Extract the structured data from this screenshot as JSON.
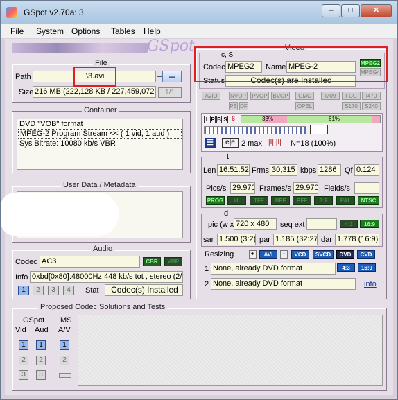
{
  "window": {
    "title": "GSpot v2.70a: 3"
  },
  "menu": [
    "File",
    "System",
    "Options",
    "Tables",
    "Help"
  ],
  "logo_text": "GSpot",
  "file": {
    "group_label": "File",
    "path_label": "Path",
    "path_value": "\\3.avi",
    "browse_label": "...",
    "size_label": "Size",
    "size_value": "216 MB (222,128 KB / 227,459,072",
    "page_indicator": "1/1"
  },
  "container": {
    "group_label": "Container",
    "lines": [
      "DVD \"VOB\" format",
      "MPEG-2 Program Stream << ( 1 vid, 1 aud )",
      "Sys Bitrate: 10080 kb/s VBR"
    ]
  },
  "userdata": {
    "group_label": "User Data / Metadata"
  },
  "audio": {
    "group_label": "Audio",
    "codec_label": "Codec",
    "codec_value": "AC3",
    "cbr_label": "CBR",
    "vbr_label": "VBR",
    "info_label": "Info",
    "info_value": "0xbd[0x80]:48000Hz  448 kb/s tot , stereo (2/",
    "stream_buttons": [
      "1",
      "2",
      "3",
      "4"
    ],
    "stat_label": "Stat",
    "stat_value": "Codec(s) Installed"
  },
  "video": {
    "group_label": "Video",
    "cs_label": "c, S",
    "codec_label": "Codec",
    "codec_value": "MPEG2",
    "name_label": "Name",
    "name_value": "MPEG-2",
    "mpeg2_badge": "MPEG2",
    "mpeg4_badge": "MPEG4",
    "status_label": "Status",
    "status_value": "Codec(s) are Installed",
    "profile_buttons_row1": [
      "AVID",
      "NVOP",
      "PVOP",
      "BVOP",
      "GMC",
      "I709",
      "FCC",
      "I470"
    ],
    "profile_buttons_row2": [
      "PB",
      "DF",
      "OPEL",
      "S170",
      "S240"
    ],
    "frame_bar": {
      "type_letters": [
        "I",
        "P",
        "B",
        "S"
      ],
      "pct_a": "33%",
      "pct_b": "61%",
      "pct_a_value": 33,
      "pct_b_value": 61,
      "indicator": "6"
    },
    "gop": {
      "e_labels": [
        "e",
        "e"
      ],
      "max_label": "2 max",
      "i_labels": [
        "I",
        "I"
      ],
      "n_label": "N=18 (100%)"
    },
    "t_label": "t",
    "len_label": "Len",
    "len_value": "16:51.52",
    "frms_label": "Frms",
    "frms_value": "30,315",
    "kbps_label": "kbps",
    "kbps_value": "1286",
    "qf_label": "Qf",
    "qf_value": "0.124",
    "pics_label": "Pics/s",
    "pics_value": "29.970",
    "frames_label": "Frames/s",
    "frames_value": "29.970",
    "fields_label": "Fields/s",
    "fields_value": "",
    "scan_buttons": [
      "PROG",
      "I/L",
      "TFF",
      "BFF",
      "PFF",
      "3:2",
      "PAL",
      "NTSC"
    ],
    "d_label": "d",
    "pic_label": "pic (w x h)",
    "pic_value": "720 x 480",
    "seq_label": "seq ext",
    "seq_value": "",
    "ar_buttons": [
      "4:3",
      "16:9"
    ],
    "sar_label": "sar",
    "sar_value": "1.500 (3:2)",
    "par_label": "par",
    "par_value": "1.185 (32:27",
    "dar_label": "dar",
    "dar_value": "1.778 (16:9)",
    "resizing_label": "Resizing",
    "resize_buttons": [
      "+",
      "AVI",
      "-",
      "VCD",
      "SVCD",
      "DVD",
      "CVD"
    ],
    "resize_ar": [
      "4:3",
      "16:9"
    ],
    "resize_1_label": "1",
    "resize_1_value": "None, already DVD format",
    "resize_2_label": "2",
    "resize_2_value": "None, already DVD format",
    "info_link": "info"
  },
  "proposed": {
    "group_label": "Proposed Codec Solutions and Tests",
    "gspot_label": "GSpot",
    "vid_label": "Vid",
    "aud_label": "Aud",
    "ms_label": "MS",
    "av_label": "A/V",
    "vid_buttons": [
      "1",
      "2",
      "3"
    ],
    "aud_buttons": [
      "1",
      "2",
      "3"
    ],
    "ms_buttons": [
      "1",
      "2"
    ]
  },
  "colors": {
    "highlight_red": "#e02020",
    "field_bg": "#f8f8e0",
    "group_bg": "#e6dfe8",
    "bar_red": "#e03030",
    "bar_green": "#b8e8a0",
    "bar_pink": "#f0a8c0"
  }
}
